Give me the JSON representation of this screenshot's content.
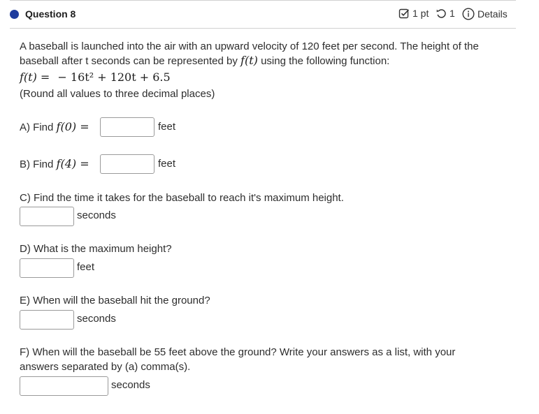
{
  "question": {
    "title": "Question 8",
    "points": "1 pt",
    "retries": "1",
    "details_label": "Details"
  },
  "intro": {
    "line1": "A baseball is launched into the air with an upward velocity of 120 feet per second. The height of the",
    "line2_prefix": "baseball after t seconds can be represented by",
    "line2_fn": "f(t)",
    "line2_suffix": "using the following function:",
    "equation_lhs": "f(t) =",
    "equation_rhs": "− 16t² + 120t + 6.5",
    "note": "(Round all values to three decimal places)"
  },
  "parts": {
    "a": {
      "prefix": "A) Find",
      "expr": "f(0) =",
      "value": "",
      "unit": "feet"
    },
    "b": {
      "prefix": "B) Find",
      "expr": "f(4) =",
      "value": "",
      "unit": "feet"
    },
    "c": {
      "prompt": "C) Find the time it takes for the baseball to reach it's maximum height.",
      "value": "",
      "unit": "seconds"
    },
    "d": {
      "prompt": "D) What is the maximum height?",
      "value": "",
      "unit": "feet"
    },
    "e": {
      "prompt": "E) When will the baseball hit the ground?",
      "value": "",
      "unit": "seconds"
    },
    "f": {
      "prompt_line1": "F) When will the baseball be 55 feet above the ground? Write your answers as a list, with your",
      "prompt_line2": "answers separated by (a) comma(s).",
      "value": "",
      "unit": "seconds"
    }
  },
  "colors": {
    "accent": "#1f3c9e",
    "border": "#9a9a9a",
    "text": "#2d2d2d"
  }
}
